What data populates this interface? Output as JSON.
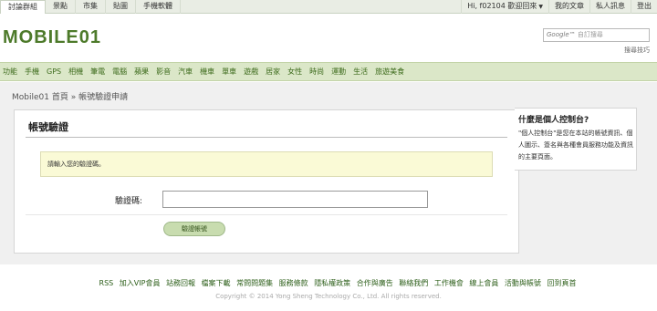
{
  "topbar": {
    "tabs": [
      "討論群組",
      "景點",
      "市集",
      "貼圖",
      "手機軟體"
    ],
    "user_greeting": "Hi, f02104 歡迎回來",
    "right_items": [
      "我的文章",
      "私人訊息",
      "登出"
    ]
  },
  "header": {
    "logo_text": "MOBILE01",
    "search_google": "Google™",
    "search_placeholder": "自訂搜尋",
    "search_tips": "搜尋技巧"
  },
  "categories": [
    "功能",
    "手機",
    "GPS",
    "相機",
    "筆電",
    "電腦",
    "蘋果",
    "影音",
    "汽車",
    "機車",
    "單車",
    "遊戲",
    "居家",
    "女性",
    "時尚",
    "運動",
    "生活",
    "旅遊美食"
  ],
  "breadcrumb": "Mobile01 首頁 » 帳號驗證申請",
  "form": {
    "title": "帳號驗證",
    "notice": "請輸入您的驗證碼。",
    "code_label": "驗證碼:",
    "code_value": "",
    "submit_label": "驗證帳號"
  },
  "sidebar": {
    "title": "什麼是個人控制台?",
    "body": "\"個人控制台\"是您在本站的帳號資訊、個人圖示、簽名與各種會員服務功能及資訊的主要頁面。"
  },
  "footer": {
    "links": [
      "RSS",
      "加入VIP會員",
      "站務回報",
      "檔案下載",
      "常問問題集",
      "服務條款",
      "隱私權政策",
      "合作與廣告",
      "聯絡我們",
      "工作機會",
      "線上會員",
      "活動與帳號",
      "回到頁首"
    ],
    "copyright": "Copyright © 2014 Yong Sheng Technology Co., Ltd. All rights reserved."
  },
  "colors": {
    "brand": "#4d7a2a",
    "nav_bg": "#dbe7c8",
    "notice_bg": "#fafad6",
    "button_bg": "#c8dcaf"
  }
}
